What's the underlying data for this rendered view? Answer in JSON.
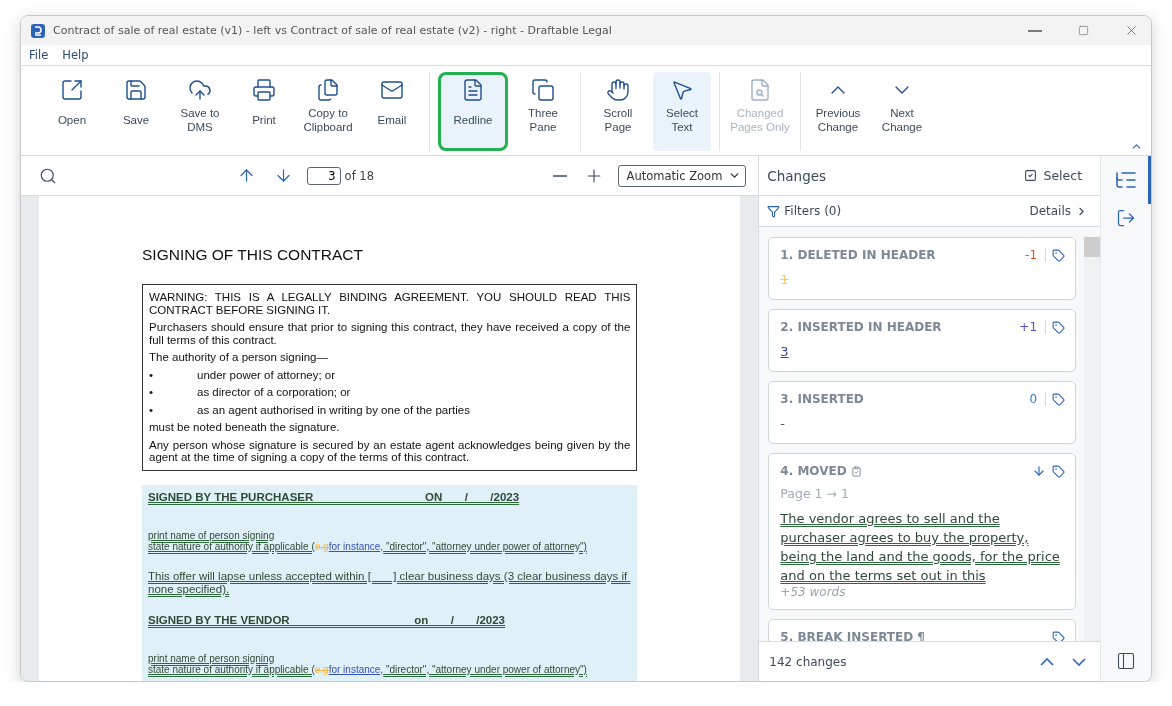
{
  "window": {
    "title": "Contract of sale of real estate (v1) - left vs Contract of sale of real estate (v2) - right - Draftable Legal"
  },
  "menu": [
    "File",
    "Help"
  ],
  "toolbar": {
    "groups": [
      [
        {
          "label": "Open",
          "selected": false,
          "disabled": false,
          "highlighted": false
        },
        {
          "label": "Save",
          "selected": false,
          "disabled": false,
          "highlighted": false
        },
        {
          "label": "Save to DMS",
          "selected": false,
          "disabled": false,
          "highlighted": false
        },
        {
          "label": "Print",
          "selected": false,
          "disabled": false,
          "highlighted": false
        },
        {
          "label": "Copy to Clipboard",
          "selected": false,
          "disabled": false,
          "highlighted": false
        },
        {
          "label": "Email",
          "selected": false,
          "disabled": false,
          "highlighted": false
        }
      ],
      [
        {
          "label": "Redline",
          "selected": true,
          "disabled": false,
          "highlighted": true
        },
        {
          "label": "Three Pane",
          "selected": false,
          "disabled": false,
          "highlighted": false
        }
      ],
      [
        {
          "label": "Scroll Page",
          "selected": false,
          "disabled": false,
          "highlighted": false
        },
        {
          "label": "Select Text",
          "selected": true,
          "disabled": false,
          "highlighted": false
        }
      ],
      [
        {
          "label": "Changed Pages Only",
          "selected": false,
          "disabled": true,
          "highlighted": false
        }
      ],
      [
        {
          "label": "Previous Change",
          "selected": false,
          "disabled": false,
          "highlighted": false
        },
        {
          "label": "Next Change",
          "selected": false,
          "disabled": false,
          "highlighted": false
        }
      ]
    ]
  },
  "viewer": {
    "page_value": "3",
    "page_total": "of 18",
    "zoom": "Automatic Zoom",
    "document": {
      "heading": "SIGNING OF THIS CONTRACT",
      "warning_box": [
        {
          "kind": "para",
          "text": "WARNING: THIS IS A LEGALLY BINDING AGREEMENT. YOU SHOULD READ THIS CONTRACT BEFORE SIGNING IT."
        },
        {
          "kind": "para",
          "text": "Purchasers should ensure that prior to signing this contract, they have received a copy of the full terms of this contract."
        },
        {
          "kind": "para",
          "text": "The authority of a person signing—"
        },
        {
          "kind": "bullet",
          "bullet": "•",
          "text": "under power of attorney; or"
        },
        {
          "kind": "bullet",
          "bullet": "•",
          "text": "as director of a corporation; or"
        },
        {
          "kind": "bullet",
          "bullet": "•",
          "text": "as an agent authorised in writing by one of the parties"
        },
        {
          "kind": "para",
          "text": "must be noted beneath the signature."
        },
        {
          "kind": "para",
          "text": "Any person whose signature is secured by an estate agent acknowledges being given by the agent at the time of signing a copy of the terms of this contract."
        }
      ],
      "moved_block": [
        {
          "kind": "signed",
          "parts": [
            {
              "kind": "moved",
              "text": "SIGNED BY THE PURCHASER                                   ON       /       /2023"
            }
          ]
        },
        {
          "kind": "small",
          "parts": [
            {
              "kind": "moved",
              "text": "print name of person signing"
            }
          ]
        },
        {
          "kind": "small",
          "parts": [
            {
              "kind": "moved",
              "text": "state nature of authority if applicable ("
            },
            {
              "kind": "deleted",
              "text": "e.g"
            },
            {
              "kind": "inserted",
              "text": "for instance,"
            },
            {
              "kind": "moved",
              "text": " \"director\", \"attorney under power of attorney\")"
            }
          ]
        },
        {
          "kind": "offer",
          "parts": [
            {
              "kind": "moved",
              "text": "This offer will lapse unless accepted within [       ] clear business days (3 clear business days if none specified)."
            }
          ]
        },
        {
          "kind": "signed",
          "parts": [
            {
              "kind": "moved",
              "text": "SIGNED BY THE VENDOR                                       on       /       /2023"
            }
          ]
        },
        {
          "kind": "small",
          "parts": [
            {
              "kind": "moved",
              "text": "print name of person signing"
            }
          ]
        },
        {
          "kind": "small",
          "parts": [
            {
              "kind": "moved",
              "text": "state nature of authority if applicable ("
            },
            {
              "kind": "deleted",
              "text": "e.g"
            },
            {
              "kind": "inserted",
              "text": "for instance,"
            },
            {
              "kind": "moved",
              "text": " \"director\", \"attorney under power of attorney\")"
            }
          ]
        }
      ]
    }
  },
  "changes": {
    "title": "Changes",
    "select": "Select",
    "filters": "Filters (0)",
    "details": "Details",
    "items": [
      {
        "kind": "deleted",
        "title": "1. DELETED IN HEADER",
        "delta": "-1",
        "color": "#d9541e",
        "body": "1"
      },
      {
        "kind": "inserted",
        "title": "2. INSERTED IN HEADER",
        "delta": "+1",
        "color": "#5a4fcf",
        "body": "3"
      },
      {
        "kind": "plain",
        "title": "3. INSERTED",
        "delta": "0",
        "color": "#2f7fd1",
        "body": "-"
      },
      {
        "kind": "moved",
        "title": "4. MOVED",
        "page": "Page 1 → 1",
        "body": "The vendor agrees to sell and the purchaser agrees to buy the property, being the land and the goods, for the price and on the terms set out in this",
        "more": "+53 words"
      },
      {
        "kind": "plain",
        "title": "5. BREAK INSERTED ¶"
      }
    ],
    "count": "142 changes"
  }
}
